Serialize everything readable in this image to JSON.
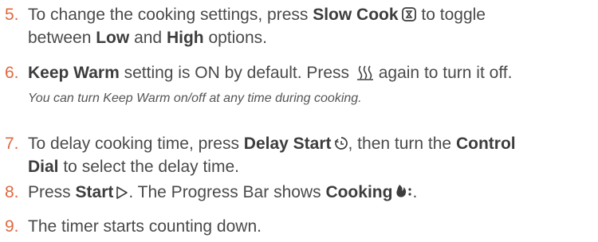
{
  "steps": [
    {
      "number": "5.",
      "line1_pre": "To change the cooking settings, press ",
      "line1_bold": "Slow Cook",
      "line1_post": " to toggle",
      "line2_pre": "between ",
      "line2_bold1": "Low",
      "line2_mid": " and ",
      "line2_bold2": "High",
      "line2_post": " options.",
      "icon": "slow-cook-icon"
    },
    {
      "number": "6.",
      "line1_bold": "Keep Warm",
      "line1_mid": " setting is ON by default. Press ",
      "line1_post": " again to turn it off.",
      "note": "You can turn Keep Warm on/off at any time during cooking.",
      "icon": "keep-warm-icon"
    },
    {
      "number": "7.",
      "line1_pre": "To delay cooking time, press ",
      "line1_bold": "Delay Start",
      "line1_mid": ", then turn the ",
      "line1_bold2": "Control",
      "line2_bold": "Dial",
      "line2_post": " to select the delay time.",
      "icon": "delay-start-icon"
    },
    {
      "number": "8.",
      "line1_pre": "Press ",
      "line1_bold": "Start",
      "line1_mid": ". The Progress Bar shows ",
      "line1_bold2": "Cooking",
      "line1_post": ".",
      "icon": "start-icon",
      "icon2": "cooking-flame-icon"
    },
    {
      "number": "9.",
      "line1_pre": "The timer starts counting down."
    }
  ],
  "colors": {
    "number": "#e0683f",
    "text": "#4a4a4a"
  }
}
